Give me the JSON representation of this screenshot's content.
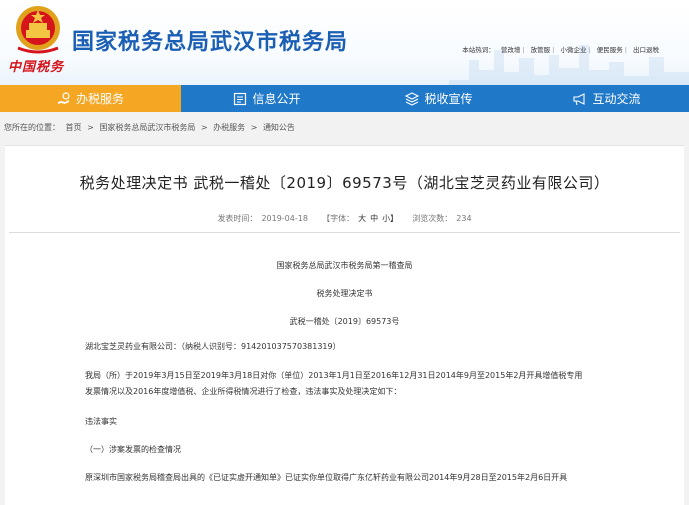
{
  "header": {
    "emblem_text": "中国税务",
    "site_title": "国家税务总局武汉市税务局",
    "top_links": [
      "本站热词：",
      "营改增",
      "放管服",
      "小微企业",
      "便民服务",
      "出口退税"
    ]
  },
  "nav": {
    "items": [
      {
        "label": "办税服务",
        "icon": "hand-coin-icon"
      },
      {
        "label": "信息公开",
        "icon": "document-list-icon"
      },
      {
        "label": "税收宣传",
        "icon": "stack-layers-icon"
      },
      {
        "label": "互动交流",
        "icon": "megaphone-icon"
      }
    ],
    "active_color": "#f5a623",
    "bar_color": "#1f78c8"
  },
  "breadcrumb": {
    "prefix": "您所在的位置：",
    "items": [
      "首页",
      "国家税务总局武汉市税务局",
      "办税服务",
      "通知公告"
    ],
    "separator": ">"
  },
  "article": {
    "title": "税务处理决定书 武税一稽处〔2019〕69573号（湖北宝芝灵药业有限公司）",
    "meta": {
      "date_label": "发表时间：",
      "date": "2019-04-18",
      "font_label": "【字体：",
      "font_large": "大",
      "font_medium": "中",
      "font_small": "小】",
      "views_label": "浏览次数：",
      "views": "234"
    },
    "org": "国家税务总局武汉市税务局第一稽查局",
    "doc_name": "税务处理决定书",
    "doc_number": "武税一稽处〔2019〕69573号",
    "addressee": "湖北宝芝灵药业有限公司：（纳税人识别号：914201037570381319）",
    "body_line1": "我局（所）于2019年3月15日至2019年3月18日对你（单位）2013年1月1日至2016年12月31日2014年9月至2015年2月开具增值税专用",
    "body_line2": "发票情况以及2016年度增值税、企业所得税情况进行了检查，违法事实及处理决定如下：",
    "section_facts": "违法事实",
    "subsection": "（一）涉案发票的检查情况",
    "body_line3": "原深圳市国家税务局稽查局出具的《已证实虚开通知单》已证实你单位取得广东亿轩药业有限公司2014年9月28日至2015年2月6日开具"
  }
}
